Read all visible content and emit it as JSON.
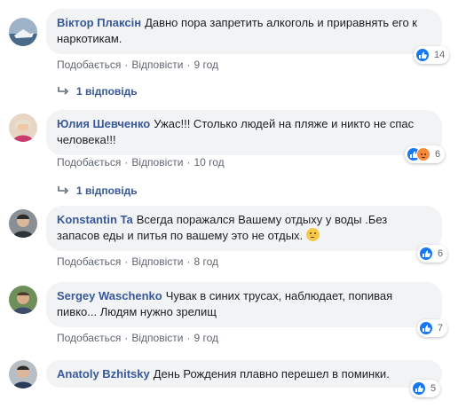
{
  "comments": [
    {
      "author": "Віктор Плаксін",
      "text": "Давно пора запретить алкоголь и приравнять его к наркотикам.",
      "like_label": "Подобається",
      "reply_label": "Відповісти",
      "time": "9 год",
      "reaction_count": "14",
      "replies": "1 відповідь"
    },
    {
      "author": "Юлия Шевченко",
      "text": "Ужас!!! Столько людей на пляже и никто не спас человека!!!",
      "like_label": "Подобається",
      "reply_label": "Відповісти",
      "time": "10 год",
      "reaction_count": "6",
      "replies": "1 відповідь"
    },
    {
      "author": "Konstantin Ta",
      "text": "Всегда поражался Вашему отдыху у воды .Без запасов еды и питья по вашему это не отдых.",
      "like_label": "Подобається",
      "reply_label": "Відповісти",
      "time": "8 год",
      "reaction_count": "6"
    },
    {
      "author": "Sergey Waschenko",
      "text": "Чувак в синих трусах, наблюдает, попивая пивко... Людям нужно зрелищ",
      "like_label": "Подобається",
      "reply_label": "Відповісти",
      "time": "9 год",
      "reaction_count": "7"
    },
    {
      "author": "Anatoly Bzhitsky",
      "text": "День Рождения плавно перешел в поминки.",
      "reaction_count": "5"
    }
  ],
  "colors": {
    "link": "#385898",
    "bubble": "#f2f3f5",
    "like": "#1877f2"
  },
  "icons": [
    "like-icon",
    "angry-icon",
    "reply-arrow-icon",
    "thinking-emoji-icon"
  ]
}
